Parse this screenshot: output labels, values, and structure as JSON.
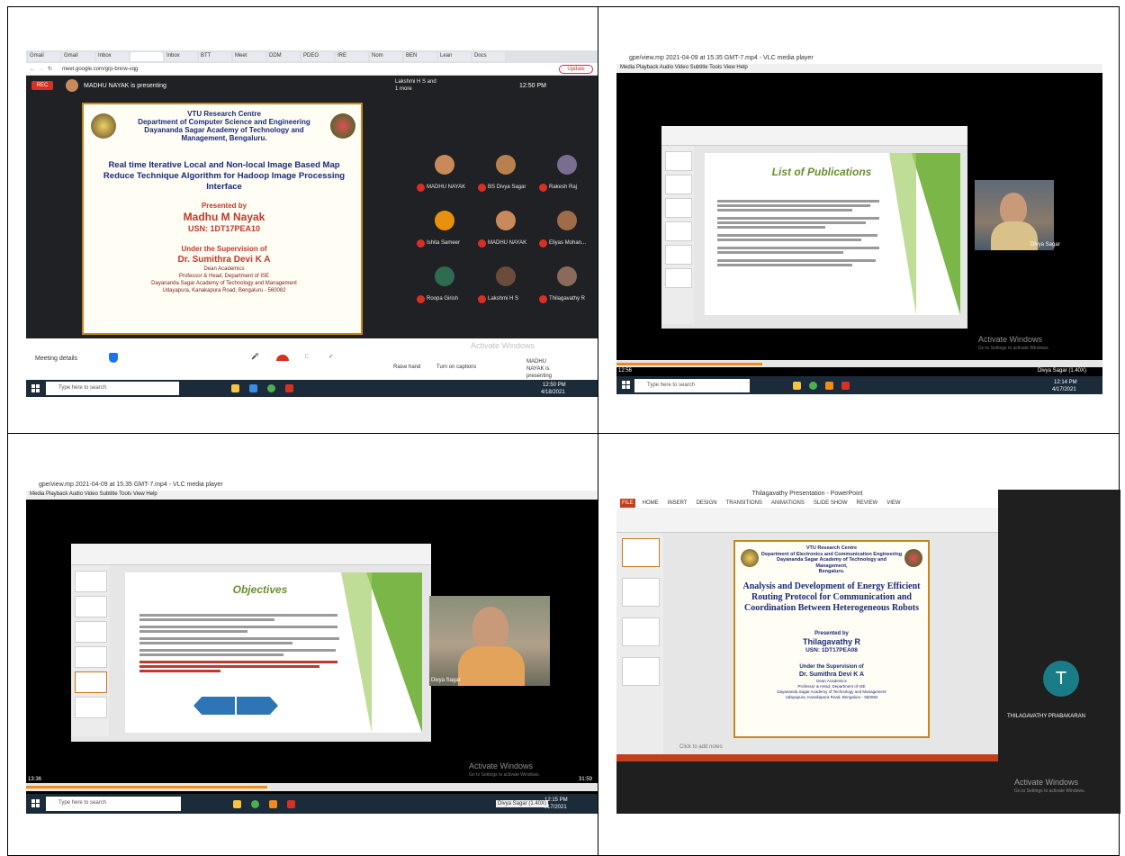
{
  "q1": {
    "browser": {
      "tabs": [
        "Gmail",
        "Gmail",
        "Inbox",
        "",
        "Inbox",
        "BTT",
        "Meet",
        "DDM",
        "PDEO",
        "IRE",
        "Nom",
        "BEN",
        "Lean",
        "Docs"
      ],
      "url": "meet.google.com/grp-bnnw-vqg",
      "profile_label": "Update"
    },
    "meet": {
      "rec_label": "REC",
      "presenter_text": "MADHU NAYAK is presenting",
      "lakshmi_label": "Lakshmi H S and 1 more",
      "time": "12:50 PM",
      "meeting_details": "Meeting details",
      "raise_hand": "Raise hand",
      "turn_on_captions": "Turn on captions",
      "presenting_label": "MADHU NAYAK is presenting",
      "activate_windows": "Activate Windows"
    },
    "slide": {
      "line1": "VTU Research Centre",
      "line2": "Department of Computer Science and Engineering",
      "line3": "Dayananda Sagar Academy of Technology and",
      "line4": "Management, Bengaluru.",
      "title": "Real time Iterative Local and Non-local Image Based Map Reduce Technique Algorithm for Hadoop Image Processing Interface",
      "presented_by": "Presented by",
      "presenter": "Madhu M Nayak",
      "usn": "USN: 1DT17PEA10",
      "supervision": "Under the Supervision of",
      "supervisor": "Dr. Sumithra Devi K A",
      "role1": "Dean Academics",
      "role2": "Professor & Head, Department of ISE",
      "inst": "Dayananda Sagar Academy of Technology and Management",
      "addr": "Udayapura, Kanakapura Road, Bengaluru - 560082"
    },
    "participants": [
      {
        "name": "MADHU NAYAK",
        "color": "#c98a5b"
      },
      {
        "name": "BS Divya Sagar",
        "color": "#b9804f"
      },
      {
        "name": "Rakesh Raj",
        "color": "#7a6d8f"
      },
      {
        "name": "Ishita Sameer",
        "color": "#e8910d"
      },
      {
        "name": "MADHU NAYAK",
        "color": "#c98a5b"
      },
      {
        "name": "Eliyas Mohan...",
        "color": "#a06b49"
      },
      {
        "name": "Roopa Girish",
        "color": "#2f6b4f"
      },
      {
        "name": "Lakshmi H S",
        "color": "#6b4b3a"
      },
      {
        "name": "Thilagavathy R",
        "color": "#8a6a5a"
      }
    ],
    "taskbar": {
      "search": "Type here to search",
      "clock": "12:50 PM",
      "date": "4/18/2021"
    }
  },
  "q2": {
    "window_title": "gpe/view.mp 2021-04-09 at 15.35 GMT-7.mp4 - VLC media player",
    "menu": "Media  Playback  Audio  Video  Subtitle  Tools  View  Help",
    "slide_title": "List of Publications",
    "video_label": "Divya Sagar",
    "activate_windows": "Activate Windows",
    "activate_sub": "Go to Settings to activate Windows.",
    "time_left": "12:56",
    "time_right": "Divya Sagar (1.40X)",
    "taskbar": {
      "search": "Type here to search",
      "clock": "12:14 PM",
      "date": "4/17/2021"
    }
  },
  "q3": {
    "window_title": "gpe/view.mp 2021-04-09 at 15.35 GMT-7.mp4 - VLC media player",
    "menu": "Media  Playback  Audio  Video  Subtitle  Tools  View  Help",
    "slide_title": "Objectives",
    "video_label": "Divya Sagar",
    "activate_windows": "Activate Windows",
    "activate_sub": "Go to Settings to activate Windows.",
    "time_left": "13:36",
    "time_right": "31:59",
    "taskbar": {
      "search": "Type here to search",
      "clock": "12:15 PM",
      "date": "4/17/2021",
      "speed": "Divya Sagar (1.40X)"
    }
  },
  "q4": {
    "window_title": "Thilagavathy Presentation - PowerPoint",
    "ribbon_tabs": [
      "FILE",
      "HOME",
      "INSERT",
      "DESIGN",
      "TRANSITIONS",
      "ANIMATIONS",
      "SLIDE SHOW",
      "REVIEW",
      "VIEW"
    ],
    "slide": {
      "line1": "VTU Research Centre",
      "line2": "Department of Electronics and Communication Engineering",
      "line3": "Dayananda Sagar Academy of Technology and Management,",
      "line4": "Bengaluru.",
      "title": "Analysis and Development of Energy Efficient Routing Protocol for Communication and Coordination Between Heterogeneous Robots",
      "presented_by": "Presented by",
      "presenter": "Thilagavathy R",
      "usn": "USN: 1DT17PEA08",
      "supervision": "Under the Supervision of",
      "supervisor": "Dr. Sumithra Devi K A",
      "role1": "Dean Academics",
      "role2": "Professor & Head, Department of ISE",
      "inst": "Dayananda Sagar Academy of Technology and Management",
      "addr": "Udayapura, Kanakapura Road, Bengaluru - 560082"
    },
    "notes_placeholder": "Click to add notes",
    "avatar_letter": "T",
    "avatar_color": "#1a7c86",
    "participant_name": "THILAGAVATHY PRABAKARAN",
    "activate_windows": "Activate Windows",
    "activate_sub": "Go to Settings to activate Windows."
  }
}
